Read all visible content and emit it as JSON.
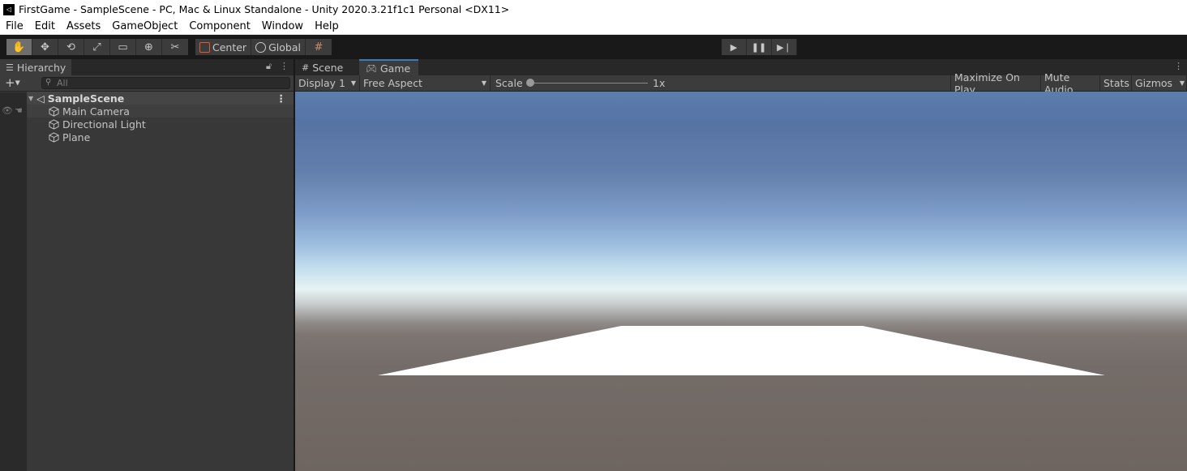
{
  "window": {
    "title": "FirstGame - SampleScene - PC, Mac & Linux Standalone - Unity 2020.3.21f1c1 Personal <DX11>"
  },
  "menu": [
    "File",
    "Edit",
    "Assets",
    "GameObject",
    "Component",
    "Window",
    "Help"
  ],
  "toolbar": {
    "transform_tools": [
      "hand-tool-icon",
      "move-tool-icon",
      "rotate-tool-icon",
      "scale-tool-icon",
      "rect-tool-icon",
      "transform-tool-icon",
      "custom-tool-icon"
    ],
    "active_tool": "hand-tool-icon",
    "pivot_label": "Center",
    "space_label": "Global"
  },
  "hierarchy": {
    "tab_label": "Hierarchy",
    "search_placeholder": "All",
    "scene_name": "SampleScene",
    "objects": [
      "Main Camera",
      "Directional Light",
      "Plane"
    ]
  },
  "game_panel": {
    "tabs": [
      "Scene",
      "Game"
    ],
    "active_tab": "Game",
    "display": "Display 1",
    "aspect": "Free Aspect",
    "scale_label": "Scale",
    "scale_value": "1x",
    "buttons": [
      "Maximize On Play",
      "Mute Audio",
      "Stats",
      "Gizmos"
    ]
  },
  "colors": {
    "accent": "#3a79bb",
    "plane": "#ffffff"
  }
}
